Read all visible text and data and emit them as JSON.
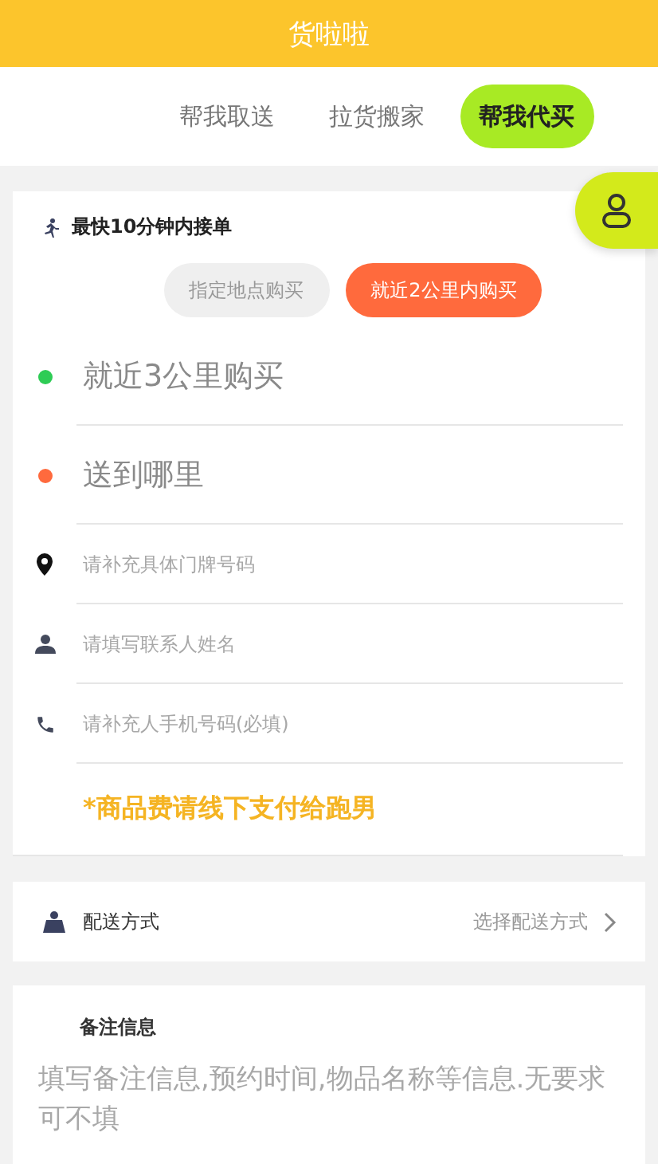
{
  "header": {
    "title": "货啦啦"
  },
  "tabs": [
    {
      "label": "帮我取送",
      "selected": false
    },
    {
      "label": "拉货搬家",
      "selected": false
    },
    {
      "label": "帮我代买",
      "selected": true
    }
  ],
  "order_card": {
    "speed_note": "最快10分钟内接单",
    "modes": [
      {
        "label": "指定地点购买",
        "selected": false
      },
      {
        "label": "就近2公里内购买",
        "selected": true
      }
    ],
    "locations": [
      {
        "text": "就近3公里购买",
        "color": "#2ecc55"
      },
      {
        "text": "送到哪里",
        "color": "#ff6a3d"
      }
    ],
    "fields": [
      {
        "kind": "address",
        "placeholder": "请补充具体门牌号码"
      },
      {
        "kind": "name",
        "placeholder": "请填写联系人姓名"
      },
      {
        "kind": "phone",
        "placeholder": "请补充人手机号码(必填)"
      }
    ],
    "notice": "*商品费请线下支付给跑男"
  },
  "delivery": {
    "label": "配送方式",
    "value": "选择配送方式"
  },
  "notes": {
    "title": "备注信息",
    "placeholder": "填写备注信息,预约时间,物品名称等信息.无要求可不填"
  }
}
